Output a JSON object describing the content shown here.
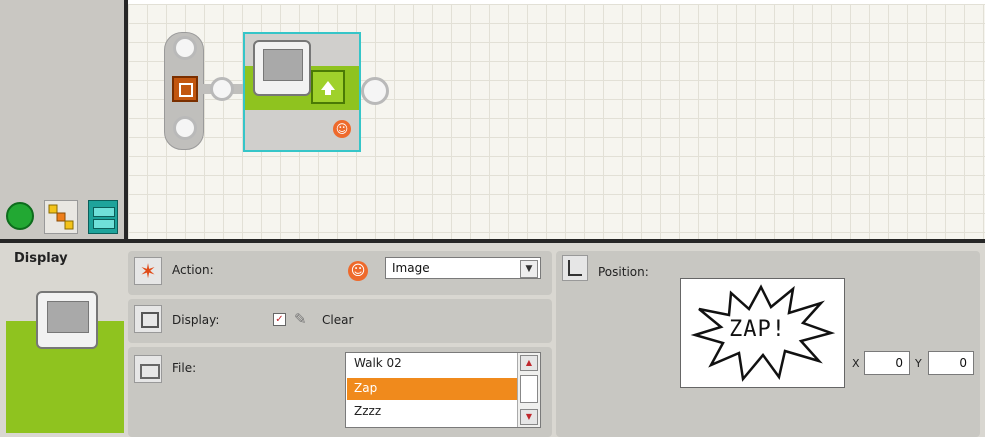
{
  "palette": {
    "tabs": [
      {
        "name": "common-palette-icon"
      },
      {
        "name": "complete-palette-icon"
      },
      {
        "name": "custom-palette-icon"
      }
    ]
  },
  "block": {
    "name": "Display"
  },
  "config": {
    "block_title": "Display",
    "action": {
      "label": "Action:",
      "value": "Image"
    },
    "display": {
      "label": "Display:",
      "clear_label": "Clear",
      "clear_checked": true
    },
    "file": {
      "label": "File:",
      "items": [
        "Walk 02",
        "Zap",
        "Zzzz"
      ],
      "selected": "Zap"
    },
    "position": {
      "label": "Position:",
      "x_label": "X",
      "x_value": "0",
      "y_label": "Y",
      "y_value": "0"
    },
    "preview_text": "ZAP!"
  },
  "colors": {
    "accent_green": "#8fc31f",
    "selection_orange": "#f08a1c",
    "selection_cyan": "#35c5c8"
  }
}
